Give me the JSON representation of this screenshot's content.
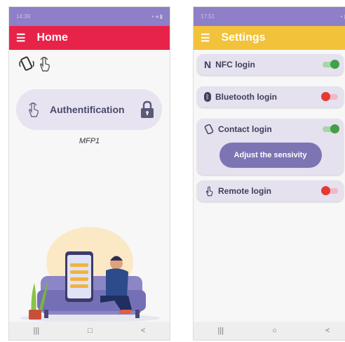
{
  "colors": {
    "home_appbar": "#e8234a",
    "settings_appbar": "#f2c23a",
    "pill": "#e7e3f1",
    "switch_on": "#43a047",
    "switch_off": "#e53935",
    "button": "#7d74b3"
  },
  "home": {
    "status_time": "14:39",
    "title": "Home",
    "auth_label": "Authentification",
    "device_name": "MFP1",
    "icons": [
      "nfc-phone-icon",
      "touch-icon",
      "fingerprint-icon",
      "lock-icon"
    ]
  },
  "settings": {
    "status_time": "17:51",
    "title": "Settings",
    "items": [
      {
        "label": "NFC login",
        "icon": "nfc-icon",
        "enabled": true
      },
      {
        "label": "Bluetooth login",
        "icon": "bluetooth-icon",
        "enabled": false
      },
      {
        "label": "Contact login",
        "icon": "contact-icon",
        "enabled": true
      },
      {
        "label": "Remote login",
        "icon": "remote-icon",
        "enabled": false
      }
    ],
    "adjust_button": "Adjust the sensivity"
  },
  "nav": {
    "recents": "|||",
    "home": "○",
    "back": "<"
  }
}
